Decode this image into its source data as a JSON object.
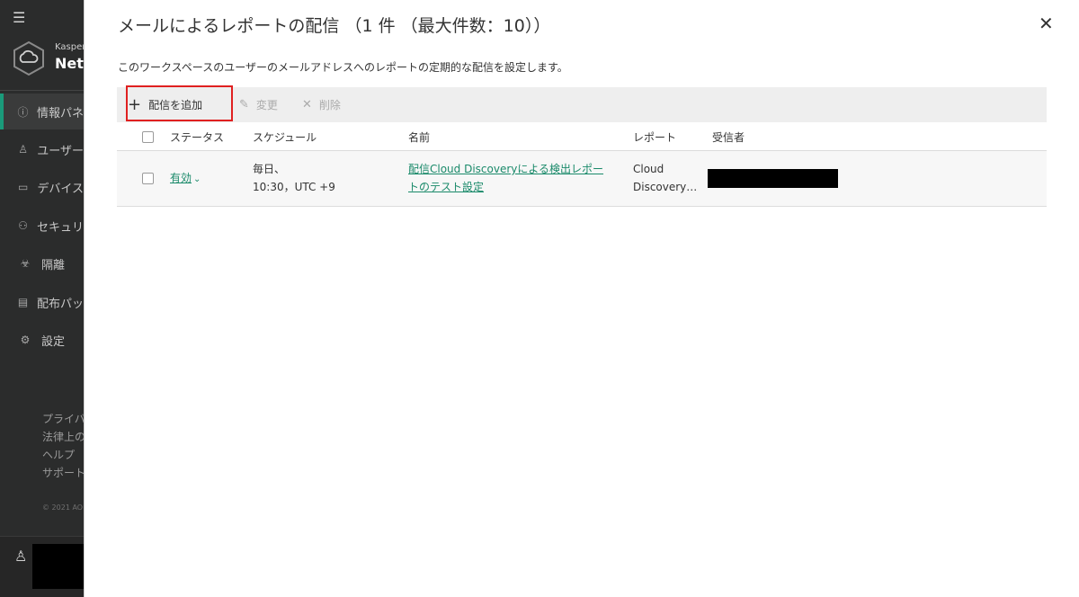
{
  "sidebar": {
    "brand_small": "Kasper",
    "brand_large": "Netw",
    "items": [
      {
        "label": "情報パネ",
        "icon": "info-icon",
        "active": true
      },
      {
        "label": "ユーザー",
        "icon": "user-icon",
        "active": false
      },
      {
        "label": "デバイス",
        "icon": "device-icon",
        "active": false
      },
      {
        "label": "セキュリ",
        "icon": "security-icon",
        "active": false
      },
      {
        "label": "隔離",
        "icon": "quarantine-icon",
        "active": false
      },
      {
        "label": "配布パッ",
        "icon": "package-icon",
        "active": false
      },
      {
        "label": "設定",
        "icon": "gear-icon",
        "active": false
      }
    ],
    "links": [
      "プライバ",
      "法律上の",
      "ヘルプ",
      "サポート"
    ],
    "copyright": "© 2021 AO"
  },
  "panel": {
    "title": "メールによるレポートの配信 （1 件 （最大件数：10））",
    "description": "このワークスペースのユーザーのメールアドレスへのレポートの定期的な配信を設定します。",
    "toolbar": {
      "add_label": "配信を追加",
      "edit_label": "変更",
      "delete_label": "削除"
    },
    "table": {
      "headers": {
        "status": "ステータス",
        "schedule": "スケジュール",
        "name": "名前",
        "report": "レポート",
        "recipients": "受信者"
      },
      "rows": [
        {
          "status": "有効",
          "schedule_line1": "毎日、",
          "schedule_line2": "10:30，UTC +9",
          "name_line1": "配信Cloud Discoveryによる検出レポー",
          "name_line2": "トのテスト設定",
          "report_line1": "Cloud",
          "report_line2": "Discovery…"
        }
      ]
    }
  },
  "colors": {
    "accent": "#1a8a6a",
    "highlight": "#e02020",
    "sidebar_bg": "#2b2c2c"
  }
}
